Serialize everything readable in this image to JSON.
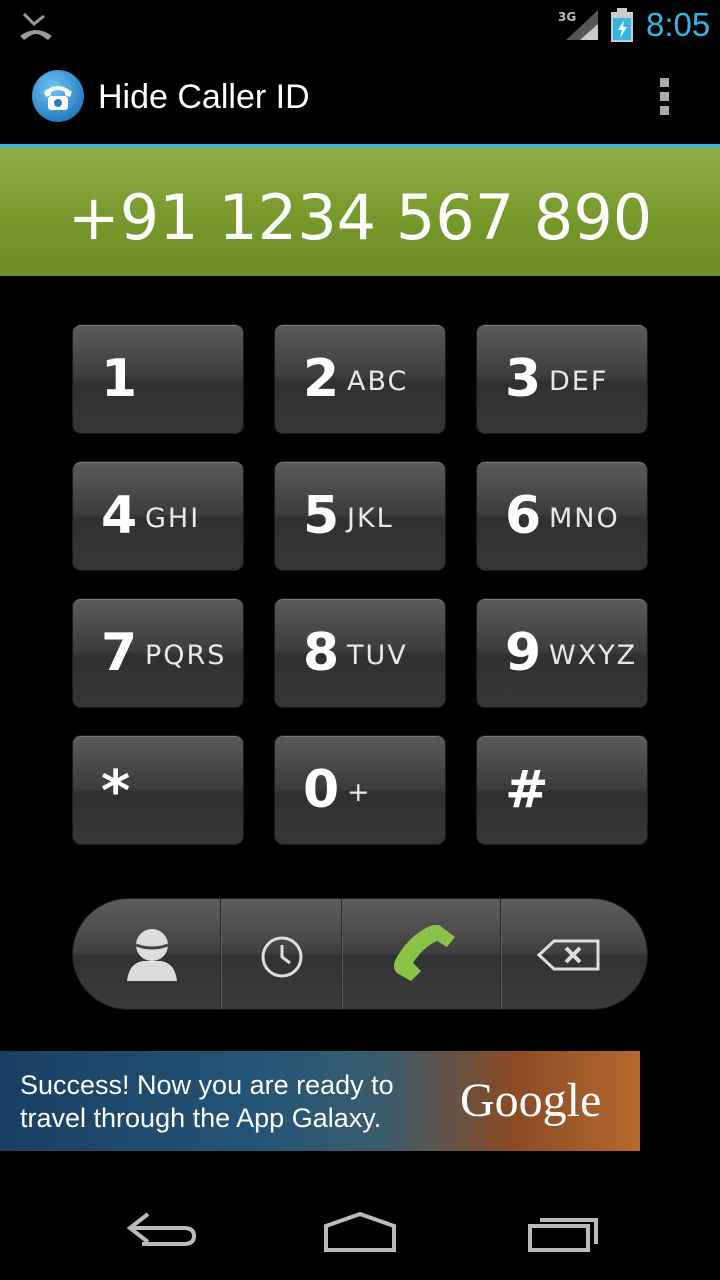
{
  "status_bar": {
    "time": "8:05",
    "network": "3G",
    "icons": [
      "missed-call-icon",
      "signal-icon",
      "battery-charging-icon"
    ]
  },
  "action_bar": {
    "title": "Hide Caller ID",
    "icons": [
      "app-phone-icon",
      "overflow-menu-icon"
    ]
  },
  "display": {
    "number": "+91 1234 567 890"
  },
  "keypad": {
    "keys": [
      {
        "digit": "1",
        "letters": ""
      },
      {
        "digit": "2",
        "letters": "ABC"
      },
      {
        "digit": "3",
        "letters": "DEF"
      },
      {
        "digit": "4",
        "letters": "GHI"
      },
      {
        "digit": "5",
        "letters": "JKL"
      },
      {
        "digit": "6",
        "letters": "MNO"
      },
      {
        "digit": "7",
        "letters": "PQRS"
      },
      {
        "digit": "8",
        "letters": "TUV"
      },
      {
        "digit": "9",
        "letters": "WXYZ"
      },
      {
        "digit": "*",
        "letters": ""
      },
      {
        "digit": "0",
        "letters": "+"
      },
      {
        "digit": "#",
        "letters": ""
      }
    ]
  },
  "actions": {
    "icons": [
      "contacts-icon",
      "call-log-icon",
      "call-icon",
      "backspace-icon"
    ]
  },
  "ad": {
    "line1": "Success! Now you are ready to",
    "line2": "travel through the App Galaxy.",
    "brand": "Google"
  },
  "nav": {
    "icons": [
      "back-icon",
      "home-icon",
      "recent-apps-icon"
    ]
  },
  "colors": {
    "accent": "#33b5e5",
    "display_green": "#7a9a2e",
    "call_green": "#8bc34a"
  }
}
